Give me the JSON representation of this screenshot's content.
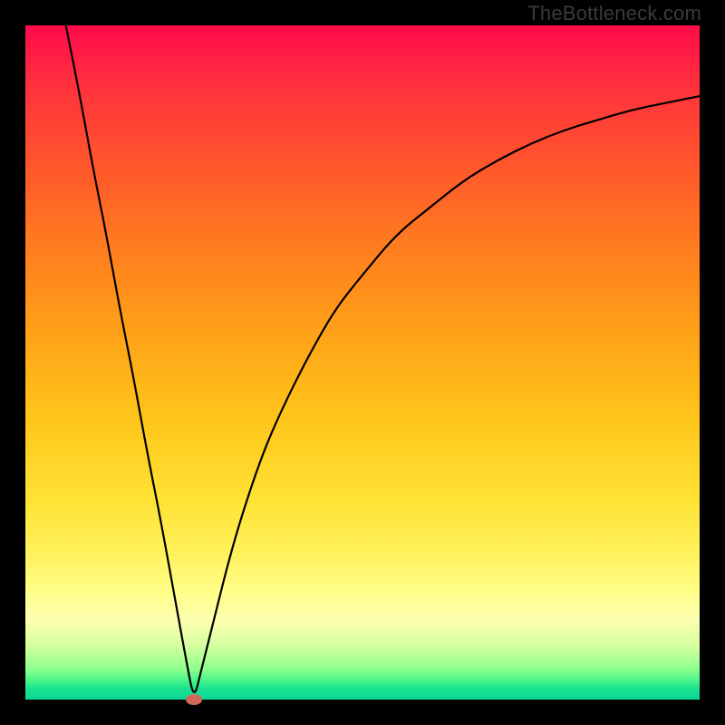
{
  "watermark": "TheBottleneck.com",
  "chart_data": {
    "type": "line",
    "title": "",
    "xlabel": "",
    "ylabel": "",
    "xlim": [
      0,
      100
    ],
    "ylim": [
      0,
      100
    ],
    "grid": false,
    "legend": false,
    "marker": {
      "x": 25,
      "y": 0,
      "color": "#cf6a5a"
    },
    "series": [
      {
        "name": "curve",
        "color": "#000000",
        "x": [
          6,
          8,
          10,
          12,
          14,
          16,
          18,
          20,
          22,
          24,
          25,
          26,
          28,
          30,
          32,
          35,
          38,
          42,
          46,
          50,
          55,
          60,
          65,
          70,
          75,
          80,
          85,
          90,
          95,
          100
        ],
        "y": [
          100,
          90,
          79,
          69,
          58,
          48,
          37,
          27,
          16,
          5,
          0,
          4,
          12,
          20,
          27,
          36,
          43,
          51,
          58,
          63,
          69,
          73,
          77,
          80,
          82.5,
          84.5,
          86,
          87.5,
          88.5,
          89.5
        ]
      }
    ],
    "background_gradient": {
      "top": "#ff0a4a",
      "middle": "#ffe233",
      "bottom": "#0cd698"
    }
  }
}
